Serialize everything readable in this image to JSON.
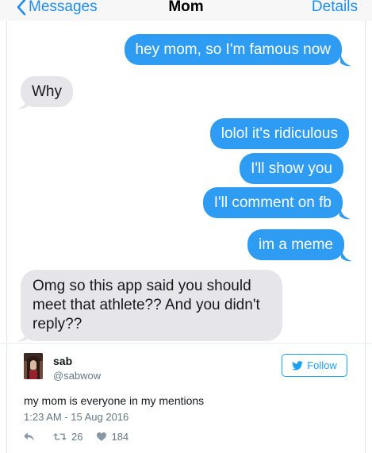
{
  "header": {
    "back_label": "Messages",
    "title": "Mom",
    "details_label": "Details",
    "accent_color": "#1f8cf2"
  },
  "messages": [
    {
      "from": "me",
      "text": "hey mom, so I'm famous now"
    },
    {
      "from": "mom",
      "text": "Why"
    },
    {
      "from": "me",
      "text": "lolol it's ridiculous"
    },
    {
      "from": "me",
      "text": "I'll show you"
    },
    {
      "from": "me",
      "text": "I'll comment on fb"
    },
    {
      "from": "me",
      "text": "im a meme"
    },
    {
      "from": "mom",
      "text": "Omg so this app said you should meet that athlete?? And you didn't reply??"
    }
  ],
  "colors": {
    "outgoing_bubble": "#2f9cf4",
    "incoming_bubble": "#e5e5ea",
    "twitter_blue": "#1da1f2"
  },
  "tweet": {
    "name": "sab",
    "handle": "@sabwow",
    "follow_label": "Follow",
    "text": "my mom is everyone in my mentions",
    "timestamp": "1:23 AM - 15 Aug 2016",
    "retweets": "26",
    "likes": "184",
    "icons": [
      "twitter-bird-icon",
      "reply-icon",
      "retweet-icon",
      "heart-icon"
    ]
  }
}
